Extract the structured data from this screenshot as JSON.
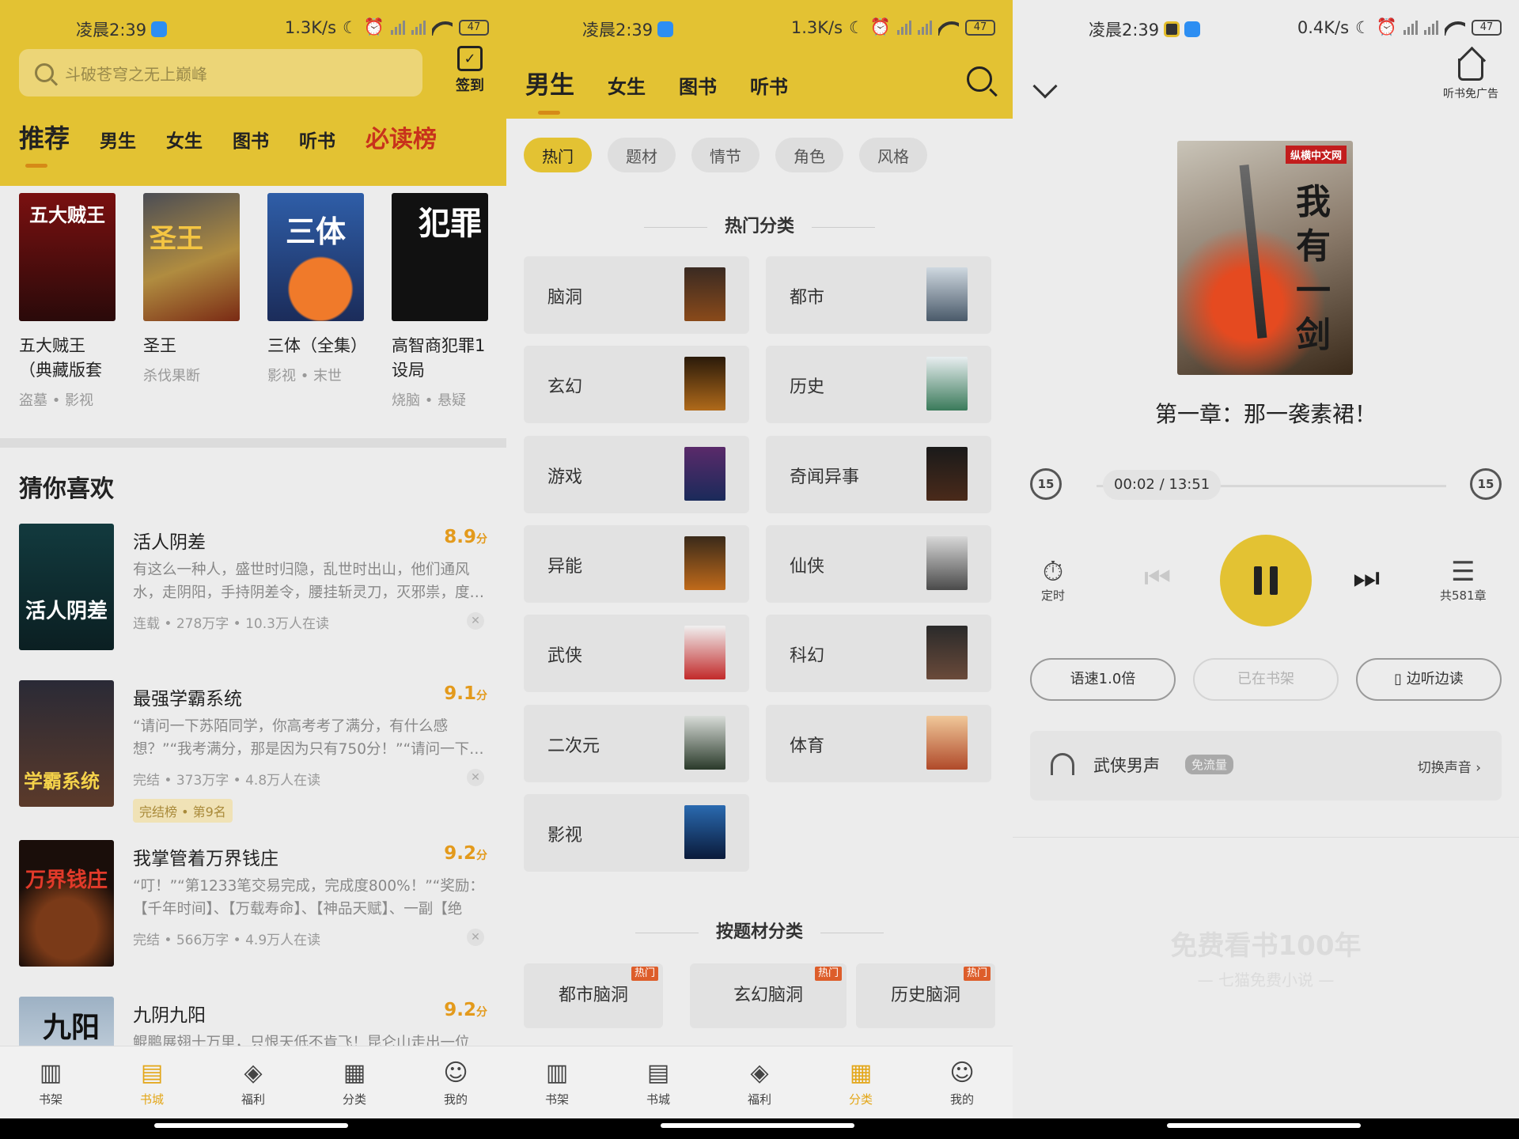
{
  "status": [
    {
      "time": "凌晨2:39",
      "speed": "1.3K/s",
      "battery": "47"
    },
    {
      "time": "凌晨2:39",
      "speed": "1.3K/s",
      "battery": "47"
    },
    {
      "time": "凌晨2:39",
      "speed": "0.4K/s",
      "battery": "47"
    }
  ],
  "colors": {
    "accent": "#e3c233",
    "accent_text": "#e3a617",
    "score": "#e39a1c",
    "hot_badge": "#dd5d2a"
  },
  "home": {
    "search_placeholder": "斗破苍穹之无上巅峰",
    "signin_label": "签到",
    "tabs": [
      "推荐",
      "男生",
      "女生",
      "图书",
      "听书",
      "必读榜"
    ],
    "top_books": [
      {
        "title": "五大贼王（典藏版套",
        "tags": "盗墓 • 影视",
        "cover_text": "五大贼王"
      },
      {
        "title": "圣王",
        "tags": "杀伐果断",
        "cover_text": "圣王"
      },
      {
        "title": "三体（全集）",
        "tags": "影视 • 末世",
        "cover_text": "三体"
      },
      {
        "title": "高智商犯罪1设局",
        "tags": "烧脑 • 悬疑",
        "cover_text": "犯罪"
      }
    ],
    "guess_title": "猜你喜欢",
    "guess_list": [
      {
        "title": "活人阴差",
        "score": "8.9",
        "unit": "分",
        "desc": "有这么一种人，盛世时归隐，乱世时出山，他们通风水，走阴阳，手持阴差令，腰挂斩灵刀，灭邪祟，度…",
        "meta": "连载 • 278万字 • 10.3万人在读",
        "cover_text": "活人阴差"
      },
      {
        "title": "最强学霸系统",
        "score": "9.1",
        "unit": "分",
        "desc": "“请问一下苏陌同学，你高考考了满分，有什么感想？”“我考满分，那是因为只有750分！”“请问一下…",
        "meta": "完结 • 373万字 • 4.8万人在读",
        "rank": "完结榜 • 第9名",
        "cover_text": "学霸系统"
      },
      {
        "title": "我掌管着万界钱庄",
        "score": "9.2",
        "unit": "分",
        "desc": "“叮！”“第1233笔交易完成，完成度800%！”“奖励：【千年时间】、【万载寿命】、【神品天赋】、一副【绝世…",
        "meta": "完结 • 566万字 • 4.9万人在读",
        "cover_text": "万界钱庄"
      },
      {
        "title": "九阴九阳",
        "score": "9.2",
        "unit": "分",
        "desc": "鲲鹏展翅十万里，只恨天低不肯飞！昆仑山走出一位",
        "cover_text": "九阳"
      }
    ]
  },
  "nav": [
    {
      "label": "书架",
      "icon": "bookshelf-icon"
    },
    {
      "label": "书城",
      "icon": "book-open-icon"
    },
    {
      "label": "福利",
      "icon": "gift-coin-icon"
    },
    {
      "label": "分类",
      "icon": "grid-icon"
    },
    {
      "label": "我的",
      "icon": "user-icon"
    }
  ],
  "category": {
    "tabs": [
      "男生",
      "女生",
      "图书",
      "听书"
    ],
    "chips": [
      "热门",
      "题材",
      "情节",
      "角色",
      "风格"
    ],
    "hot_title": "热门分类",
    "hot_items": [
      "脑洞",
      "都市",
      "玄幻",
      "历史",
      "游戏",
      "奇闻异事",
      "异能",
      "仙侠",
      "武侠",
      "科幻",
      "二次元",
      "体育",
      "影视"
    ],
    "theme_title": "按题材分类",
    "theme_items": [
      "都市脑洞",
      "玄幻脑洞",
      "历史脑洞"
    ],
    "hot_badge": "热门"
  },
  "player": {
    "no_ad": "听书免广告",
    "cover_brand": "纵横中文网",
    "cover_title": "我有一剑",
    "chapter": "第一章：那一袭素裙！",
    "time": "00:02 / 13:51",
    "progress": 0.003,
    "skip": "15",
    "timer_label": "定时",
    "chapters_label": "共581章",
    "speed_btn": "语速1.0倍",
    "shelf_btn": "已在书架",
    "read_btn": "边听边读",
    "voice_name": "武侠男声",
    "voice_badge": "免流量",
    "switch_voice": "切换声音 ›",
    "watermark_main": "免费看书100年",
    "watermark_sub": "— 七猫免费小说 —"
  }
}
